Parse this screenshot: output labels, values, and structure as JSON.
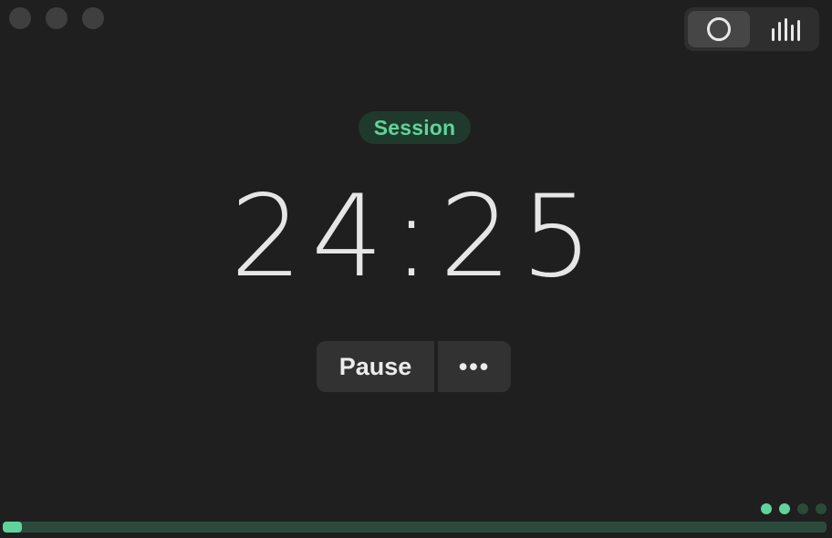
{
  "window": {
    "traffic_lights": [
      "close",
      "minimize",
      "zoom"
    ]
  },
  "view_toggle": {
    "options": [
      {
        "name": "timer-view",
        "icon": "circle-icon",
        "active": true
      },
      {
        "name": "stats-view",
        "icon": "bar-chart-icon",
        "active": false
      }
    ]
  },
  "session": {
    "label": "Session",
    "time": "24:25",
    "completed_sessions": 2,
    "total_sessions": 4,
    "progress_fraction": 0.023
  },
  "controls": {
    "pause_label": "Pause",
    "more_label": "•••"
  },
  "colors": {
    "accent": "#5fd49a",
    "accent_dim": "#2c4a3c",
    "badge_bg": "#1f3a2d",
    "background": "#1f1f1f",
    "button_bg": "#323232"
  }
}
